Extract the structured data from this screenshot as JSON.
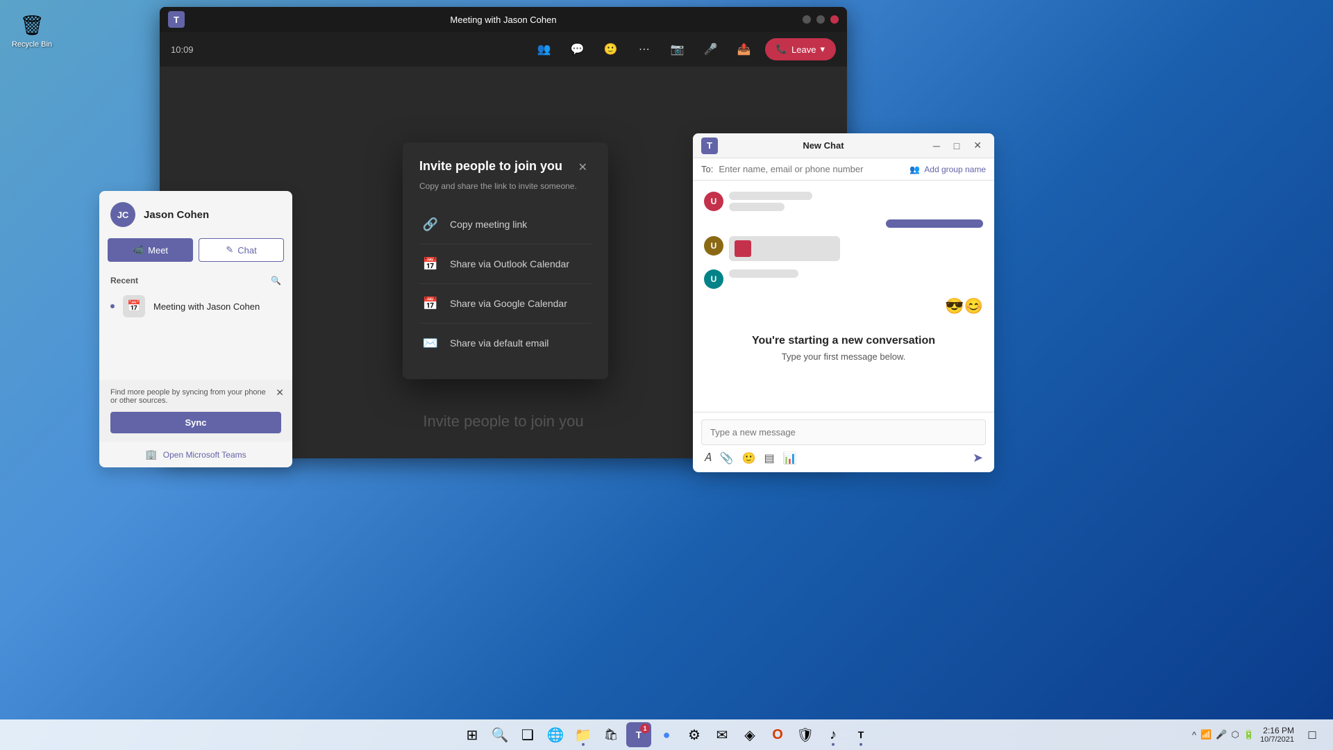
{
  "desktop": {
    "recycle_bin_label": "Recycle Bin"
  },
  "meeting_window": {
    "title": "Meeting with Jason Cohen",
    "time": "10:09",
    "leave_btn": "Leave",
    "invite_watermark": "Invite people to join you"
  },
  "invite_dialog": {
    "title": "Invite people to join you",
    "subtitle": "Copy and share the link to invite someone.",
    "options": [
      {
        "label": "Copy meeting link",
        "icon": "🔗"
      },
      {
        "label": "Share via Outlook Calendar",
        "icon": "📅"
      },
      {
        "label": "Share via Google Calendar",
        "icon": "📅"
      },
      {
        "label": "Share via default email",
        "icon": "✉️"
      }
    ]
  },
  "contact_card": {
    "initials": "JC",
    "name": "Jason Cohen",
    "meet_btn": "Meet",
    "chat_btn": "Chat",
    "recent_label": "Recent",
    "recent_item": "Meeting with Jason Cohen",
    "sync_text": "Find more people by syncing from your phone or other sources.",
    "sync_btn": "Sync",
    "open_teams": "Open Microsoft Teams"
  },
  "new_chat": {
    "title": "New Chat",
    "to_placeholder": "Enter name, email or phone number",
    "add_group_label": "Add group name",
    "new_conv_title": "You're starting a new conversation",
    "new_conv_subtitle": "Type your first message below.",
    "input_placeholder": "Type a new message",
    "emojis": "😎😊"
  },
  "taskbar": {
    "start_icon": "⊞",
    "search_icon": "🔍",
    "apps": [
      {
        "name": "start",
        "icon": "⊞"
      },
      {
        "name": "search",
        "icon": "🔍"
      },
      {
        "name": "task-view",
        "icon": "❑"
      },
      {
        "name": "edge",
        "icon": "🌐"
      },
      {
        "name": "file-explorer",
        "icon": "📁"
      },
      {
        "name": "store",
        "icon": "🛍"
      },
      {
        "name": "teams",
        "icon": "T",
        "badge": "1",
        "active": true
      },
      {
        "name": "chrome",
        "icon": "⬤"
      },
      {
        "name": "settings",
        "icon": "⚙"
      },
      {
        "name": "mail",
        "icon": "✉"
      },
      {
        "name": "edge2",
        "icon": "◈"
      },
      {
        "name": "office",
        "icon": "O"
      },
      {
        "name": "defender",
        "icon": "🛡"
      },
      {
        "name": "spotify",
        "icon": "♪"
      },
      {
        "name": "teams2",
        "icon": "T",
        "active": true
      }
    ],
    "time": "2:16 PM",
    "date": "10/7/2021"
  }
}
